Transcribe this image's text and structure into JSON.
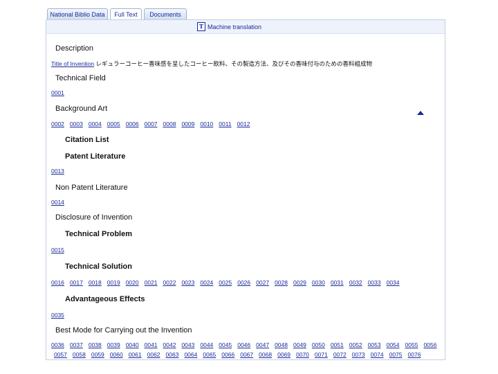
{
  "tabs": [
    {
      "label": "National Biblio Data"
    },
    {
      "label": "Full Text"
    },
    {
      "label": "Documents"
    }
  ],
  "machine_translation": {
    "icon": "T",
    "label": "Machine translation"
  },
  "sections": {
    "description": "Description",
    "title_link": "Title of Invention",
    "title_text": "レギュラーコーヒー香味感を呈したコーヒー飲料、その製造方法、及びその香味付与のための香料組成物",
    "technical_field": "Technical Field",
    "technical_field_paras": [
      "0001"
    ],
    "background_art": "Background Art",
    "background_art_paras": [
      "0002",
      "0003",
      "0004",
      "0005",
      "0006",
      "0007",
      "0008",
      "0009",
      "0010",
      "0011",
      "0012"
    ],
    "citation_list": "Citation List",
    "patent_literature": "Patent Literature",
    "patent_literature_paras": [
      "0013"
    ],
    "non_patent_literature": "Non Patent Literature",
    "non_patent_literature_paras": [
      "0014"
    ],
    "disclosure": "Disclosure of Invention",
    "technical_problem": "Technical Problem",
    "technical_problem_paras": [
      "0015"
    ],
    "technical_solution": "Technical Solution",
    "technical_solution_paras": [
      "0016",
      "0017",
      "0018",
      "0019",
      "0020",
      "0021",
      "0022",
      "0023",
      "0024",
      "0025",
      "0026",
      "0027",
      "0028",
      "0029",
      "0030",
      "0031",
      "0032",
      "0033",
      "0034"
    ],
    "advantageous_effects": "Advantageous Effects",
    "advantageous_effects_paras": [
      "0035"
    ],
    "best_mode": "Best Mode for Carrying out the Invention",
    "best_mode_paras_row1": [
      "0036",
      "0037",
      "0038",
      "0039",
      "0040",
      "0041",
      "0042",
      "0043",
      "0044",
      "0045",
      "0046",
      "0047",
      "0048",
      "0049",
      "0050",
      "0051",
      "0052",
      "0053",
      "0054",
      "0055",
      "0056"
    ],
    "best_mode_paras_row2": [
      "0057",
      "0058",
      "0059",
      "0060",
      "0061",
      "0062",
      "0063",
      "0064",
      "0065",
      "0066",
      "0067",
      "0068",
      "0069",
      "0070",
      "0071",
      "0072",
      "0073",
      "0074",
      "0075",
      "0076"
    ]
  }
}
